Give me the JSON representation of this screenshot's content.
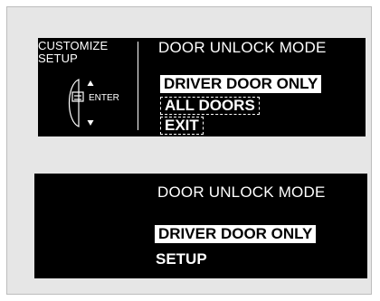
{
  "top_panel": {
    "left": {
      "title_line1": "CUSTOMIZE",
      "title_line2": "SETUP",
      "enter_label": "ENTER",
      "icons": [
        "knob-icon",
        "up-arrow-icon",
        "down-arrow-icon"
      ]
    },
    "mode_title": "DOOR UNLOCK MODE",
    "options": [
      "DRIVER DOOR ONLY",
      "ALL DOORS",
      "EXIT"
    ],
    "selected_option": "DRIVER DOOR ONLY"
  },
  "bottom_panel": {
    "mode_title": "DOOR UNLOCK MODE",
    "selected_value": "DRIVER DOOR ONLY",
    "footer_label": "SETUP"
  },
  "colors": {
    "screen_bg": "#000000",
    "frame_bg": "#e6e6e6",
    "text": "#ffffff"
  }
}
